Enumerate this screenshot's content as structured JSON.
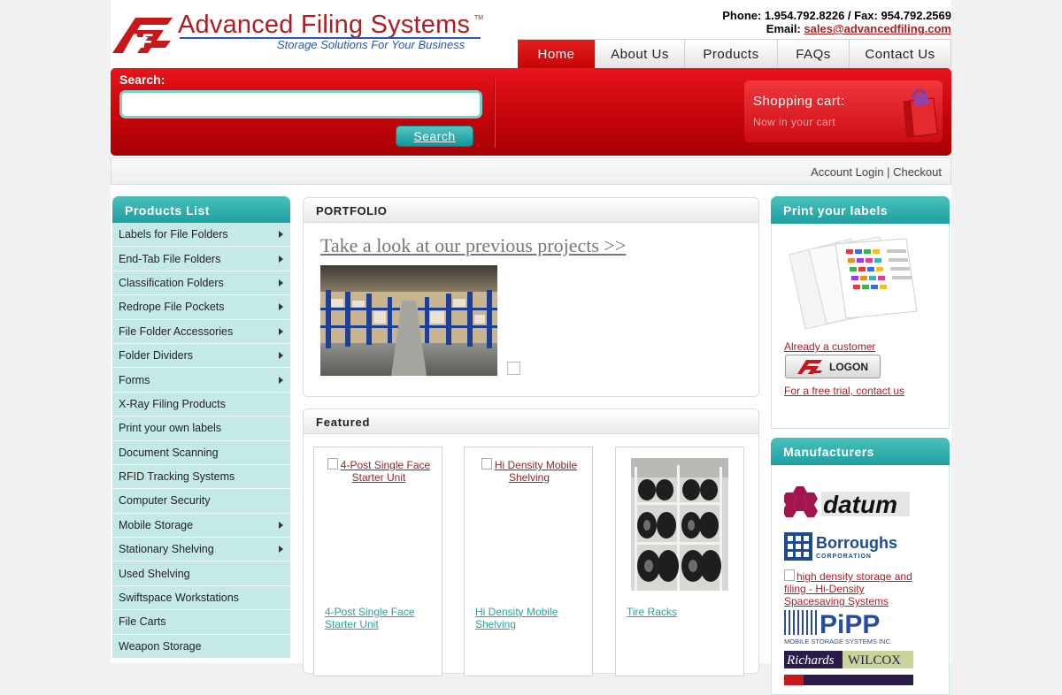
{
  "header": {
    "logo_title": "Advanced Filing Systems",
    "logo_tm": "TM",
    "logo_tagline": "Storage Solutions For Your Business",
    "phone_line": "Phone: 1.954.792.8226 / Fax: 954.792.2569",
    "email_label": "Email: ",
    "email": "sales@advancedfiling.com"
  },
  "nav": [
    {
      "label": "Home",
      "active": true
    },
    {
      "label": "About Us"
    },
    {
      "label": "Products"
    },
    {
      "label": "FAQs"
    },
    {
      "label": "Contact Us"
    }
  ],
  "search": {
    "label": "Search:",
    "value": "",
    "button": "Search"
  },
  "cart": {
    "title": "Shopping cart:",
    "subtitle": "Now in your cart"
  },
  "account": {
    "login": "Account Login",
    "separator": " | ",
    "checkout": "Checkout"
  },
  "products_list": {
    "title": "Products List",
    "items": [
      {
        "label": "Labels for File Folders",
        "arrow": true
      },
      {
        "label": "End-Tab File Folders",
        "arrow": true
      },
      {
        "label": "Classification Folders",
        "arrow": true
      },
      {
        "label": "Redrope File Pockets",
        "arrow": true
      },
      {
        "label": "File Folder Accessories",
        "arrow": true
      },
      {
        "label": "Folder Dividers",
        "arrow": true
      },
      {
        "label": "Forms",
        "arrow": true
      },
      {
        "label": "X-Ray Filing Products",
        "arrow": false
      },
      {
        "label": "Print your own labels",
        "arrow": false
      },
      {
        "label": "Document Scanning",
        "arrow": false
      },
      {
        "label": "RFID Tracking Systems",
        "arrow": false
      },
      {
        "label": "Computer Security",
        "arrow": false
      },
      {
        "label": "Mobile Storage",
        "arrow": true
      },
      {
        "label": "Stationary Shelving",
        "arrow": true
      },
      {
        "label": "Used Shelving",
        "arrow": false
      },
      {
        "label": "Swiftspace Workstations",
        "arrow": false
      },
      {
        "label": "File Carts",
        "arrow": false
      },
      {
        "label": "Weapon Storage",
        "arrow": false
      }
    ]
  },
  "portfolio": {
    "title": "PORTFOLIO",
    "link": "Take a look at our previous projects >>"
  },
  "featured": {
    "title": "Featured",
    "products": [
      {
        "image_alt": "4-Post Single Face Starter Unit",
        "name": "4-Post Single Face Starter Unit"
      },
      {
        "image_alt": "Hi Density Mobile Shelving",
        "name": "Hi Density Mobile Shelving"
      },
      {
        "image_alt": "",
        "name": "Tire Racks"
      }
    ]
  },
  "labels_panel": {
    "title": "Print your labels",
    "already_customer": "Already a customer",
    "logon_button": "LOGON",
    "free_trial": "For a free trial, contact us"
  },
  "manufacturers": {
    "title": "Manufacturers",
    "datum": "datum",
    "borroughs": "Borroughs",
    "borroughs_sub": "CORPORATION",
    "hidensity_alt": "high density storage and filing - Hi-Density Spacesaving Systems",
    "pipp": "PiPP",
    "pipp_sub": "MOBILE STORAGE SYSTEMS INC.",
    "richards": "Richards",
    "wilcox": "WILCOX"
  },
  "colors": {
    "brand_red": "#b01c22",
    "teal": "#1e9fa0",
    "link_teal": "#27a2a0"
  }
}
